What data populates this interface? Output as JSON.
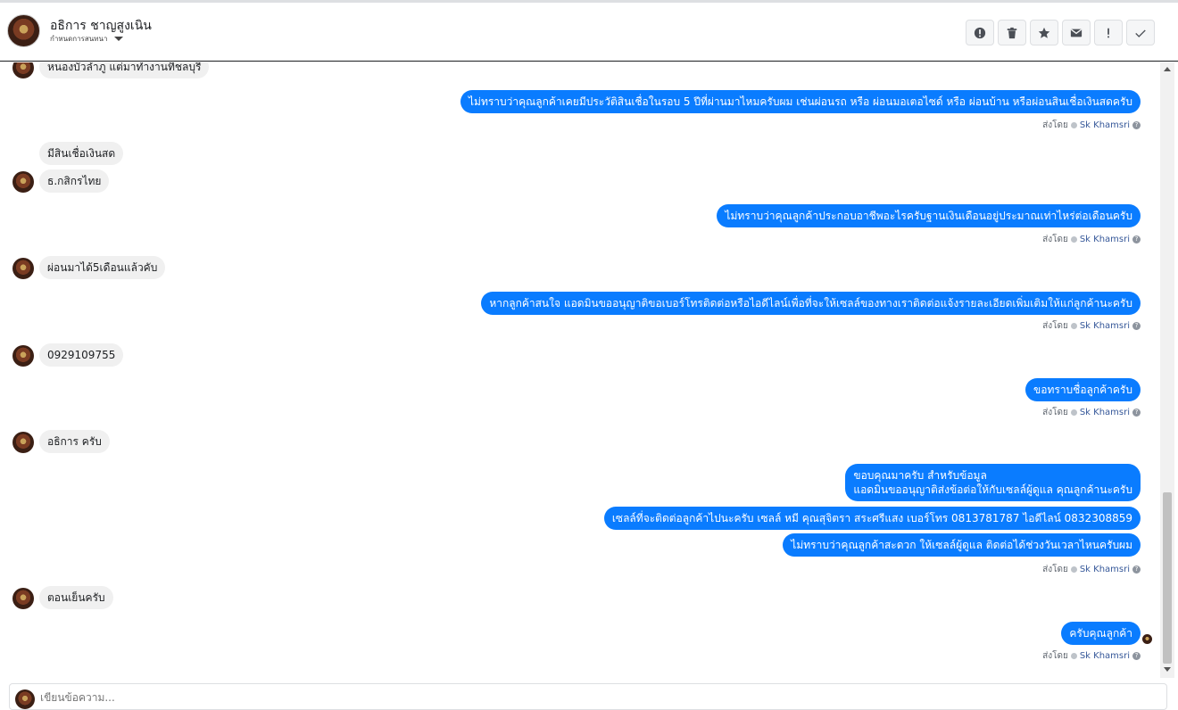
{
  "header": {
    "contact_name": "อธิการ ชาญสูงเนิน",
    "subtitle": "กำหนดการสนทนา"
  },
  "toolbar": {
    "icons": [
      "alert-circle-icon",
      "trash-icon",
      "star-icon",
      "mail-icon",
      "exclamation-icon",
      "check-icon"
    ]
  },
  "messages": {
    "in_1": "หนองบัวลำภู แต่มาทำงานที่ชลบุรี",
    "out_1": "ไม่ทราบว่าคุณลูกค้าเคยมีประวัติสินเชื่อในรอบ 5 ปีที่ผ่านมาไหมครับผม เช่นผ่อนรถ หรือ ผ่อนมอเตอไซด์ หรือ ผ่อนบ้าน หรือผ่อนสินเชื่อเงินสดครับ",
    "in_2": "มีสินเชื่อเงินสด",
    "in_3": "ธ.กสิกรไทย",
    "out_2": "ไม่ทราบว่าคุณลูกค้าประกอบอาชีพอะไรครับฐานเงินเดือนอยู่ประมาณเท่าไหร่ต่อเดือนครับ",
    "in_4": "ผ่อนมาได้5เดือนแล้วคับ",
    "out_3": "หากลูกค้าสนใจ แอดมินขออนุญาติขอเบอร์โทรติดต่อหรือไอดีไลน์เพื่อที่จะให้เซลล์ของทางเราติดต่อแจ้งรายละเอียดเพิ่มเติมให้แก่ลูกค้านะครับ",
    "in_5": "0929109755",
    "out_4": "ขอทราบชื่อลูกค้าครับ",
    "in_6": "อธิการ ครับ",
    "out_5_line1": "ขอบคุณมาครับ สำหรับข้อมูล",
    "out_5_line2": "แอดมินขออนุญาติส่งข้อต่อให้กับเซลล์ผู้ดูแล คุณลูกค้านะครับ",
    "out_6": "เซลล์ที่จะติดต่อลูกค้าไปนะครับ เซลล์ หมี คุณสุจิตรา สระศรีแสง เบอร์โทร 0813781787 ไอดีไลน์ 0832308859",
    "out_7": "ไม่ทราบว่าคุณลูกค้าสะดวก ให้เซลล์ผู้ดูแล ติดต่อได้ช่วงวันเวลาไหนครับผม",
    "in_7": "ตอนเย็นครับ",
    "out_8": "ครับคุณลูกค้า"
  },
  "sent_by": {
    "prefix": "ส่งโดย",
    "agent": "Sk Khamsri",
    "help": "?"
  },
  "composer": {
    "placeholder": "เขียนข้อความ..."
  },
  "colors": {
    "outgoing_bubble": "#0a7cff",
    "incoming_bubble": "#f0f0f0",
    "agent_link": "#365899"
  }
}
